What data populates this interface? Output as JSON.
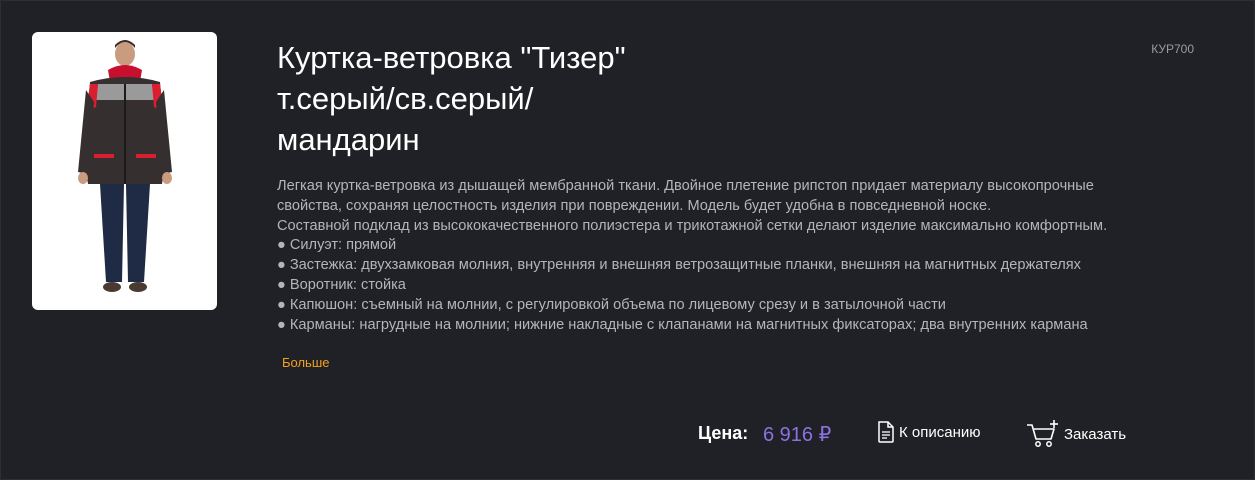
{
  "product": {
    "title_line1": "Куртка-ветровка \"Тизер\"",
    "title_line2": "т.серый/св.серый/",
    "title_line3": "мандарин",
    "sku": "КУР700",
    "description": [
      "Легкая куртка-ветровка из дышащей мембранной ткани. Двойное плетение рипстоп придает материалу высокопрочные",
      "свойства, сохраняя целостность изделия при повреждении. Модель будет удобна в повседневной носке.",
      "Составной подклад из высококачественного полиэстера и трикотажной сетки делают изделие максимально комфортным.",
      "● Силуэт: прямой",
      "● Застежка: двухзамковая молния, внутренняя и внешняя ветрозащитные планки, внешняя на магнитных держателях",
      "● Воротник: стойка",
      "● Капюшон: съемный на молнии, с регулировкой объема по лицевому срезу и в затылочной части",
      "● Карманы: нагрудные на молнии; нижние накладные с клапанами на магнитных фиксаторах; два внутренних кармана"
    ],
    "more_label": "Больше",
    "price_label": "Цена:",
    "price_value": "6 916 ₽",
    "description_button_label": "К описанию",
    "order_button_label": "Заказать",
    "image_icon": "product-photo-jacket"
  },
  "colors": {
    "background": "#202126",
    "text": "#ffffff",
    "muted_text": "#b4b5ba",
    "price": "#8c72e0",
    "link": "#f0a020"
  }
}
